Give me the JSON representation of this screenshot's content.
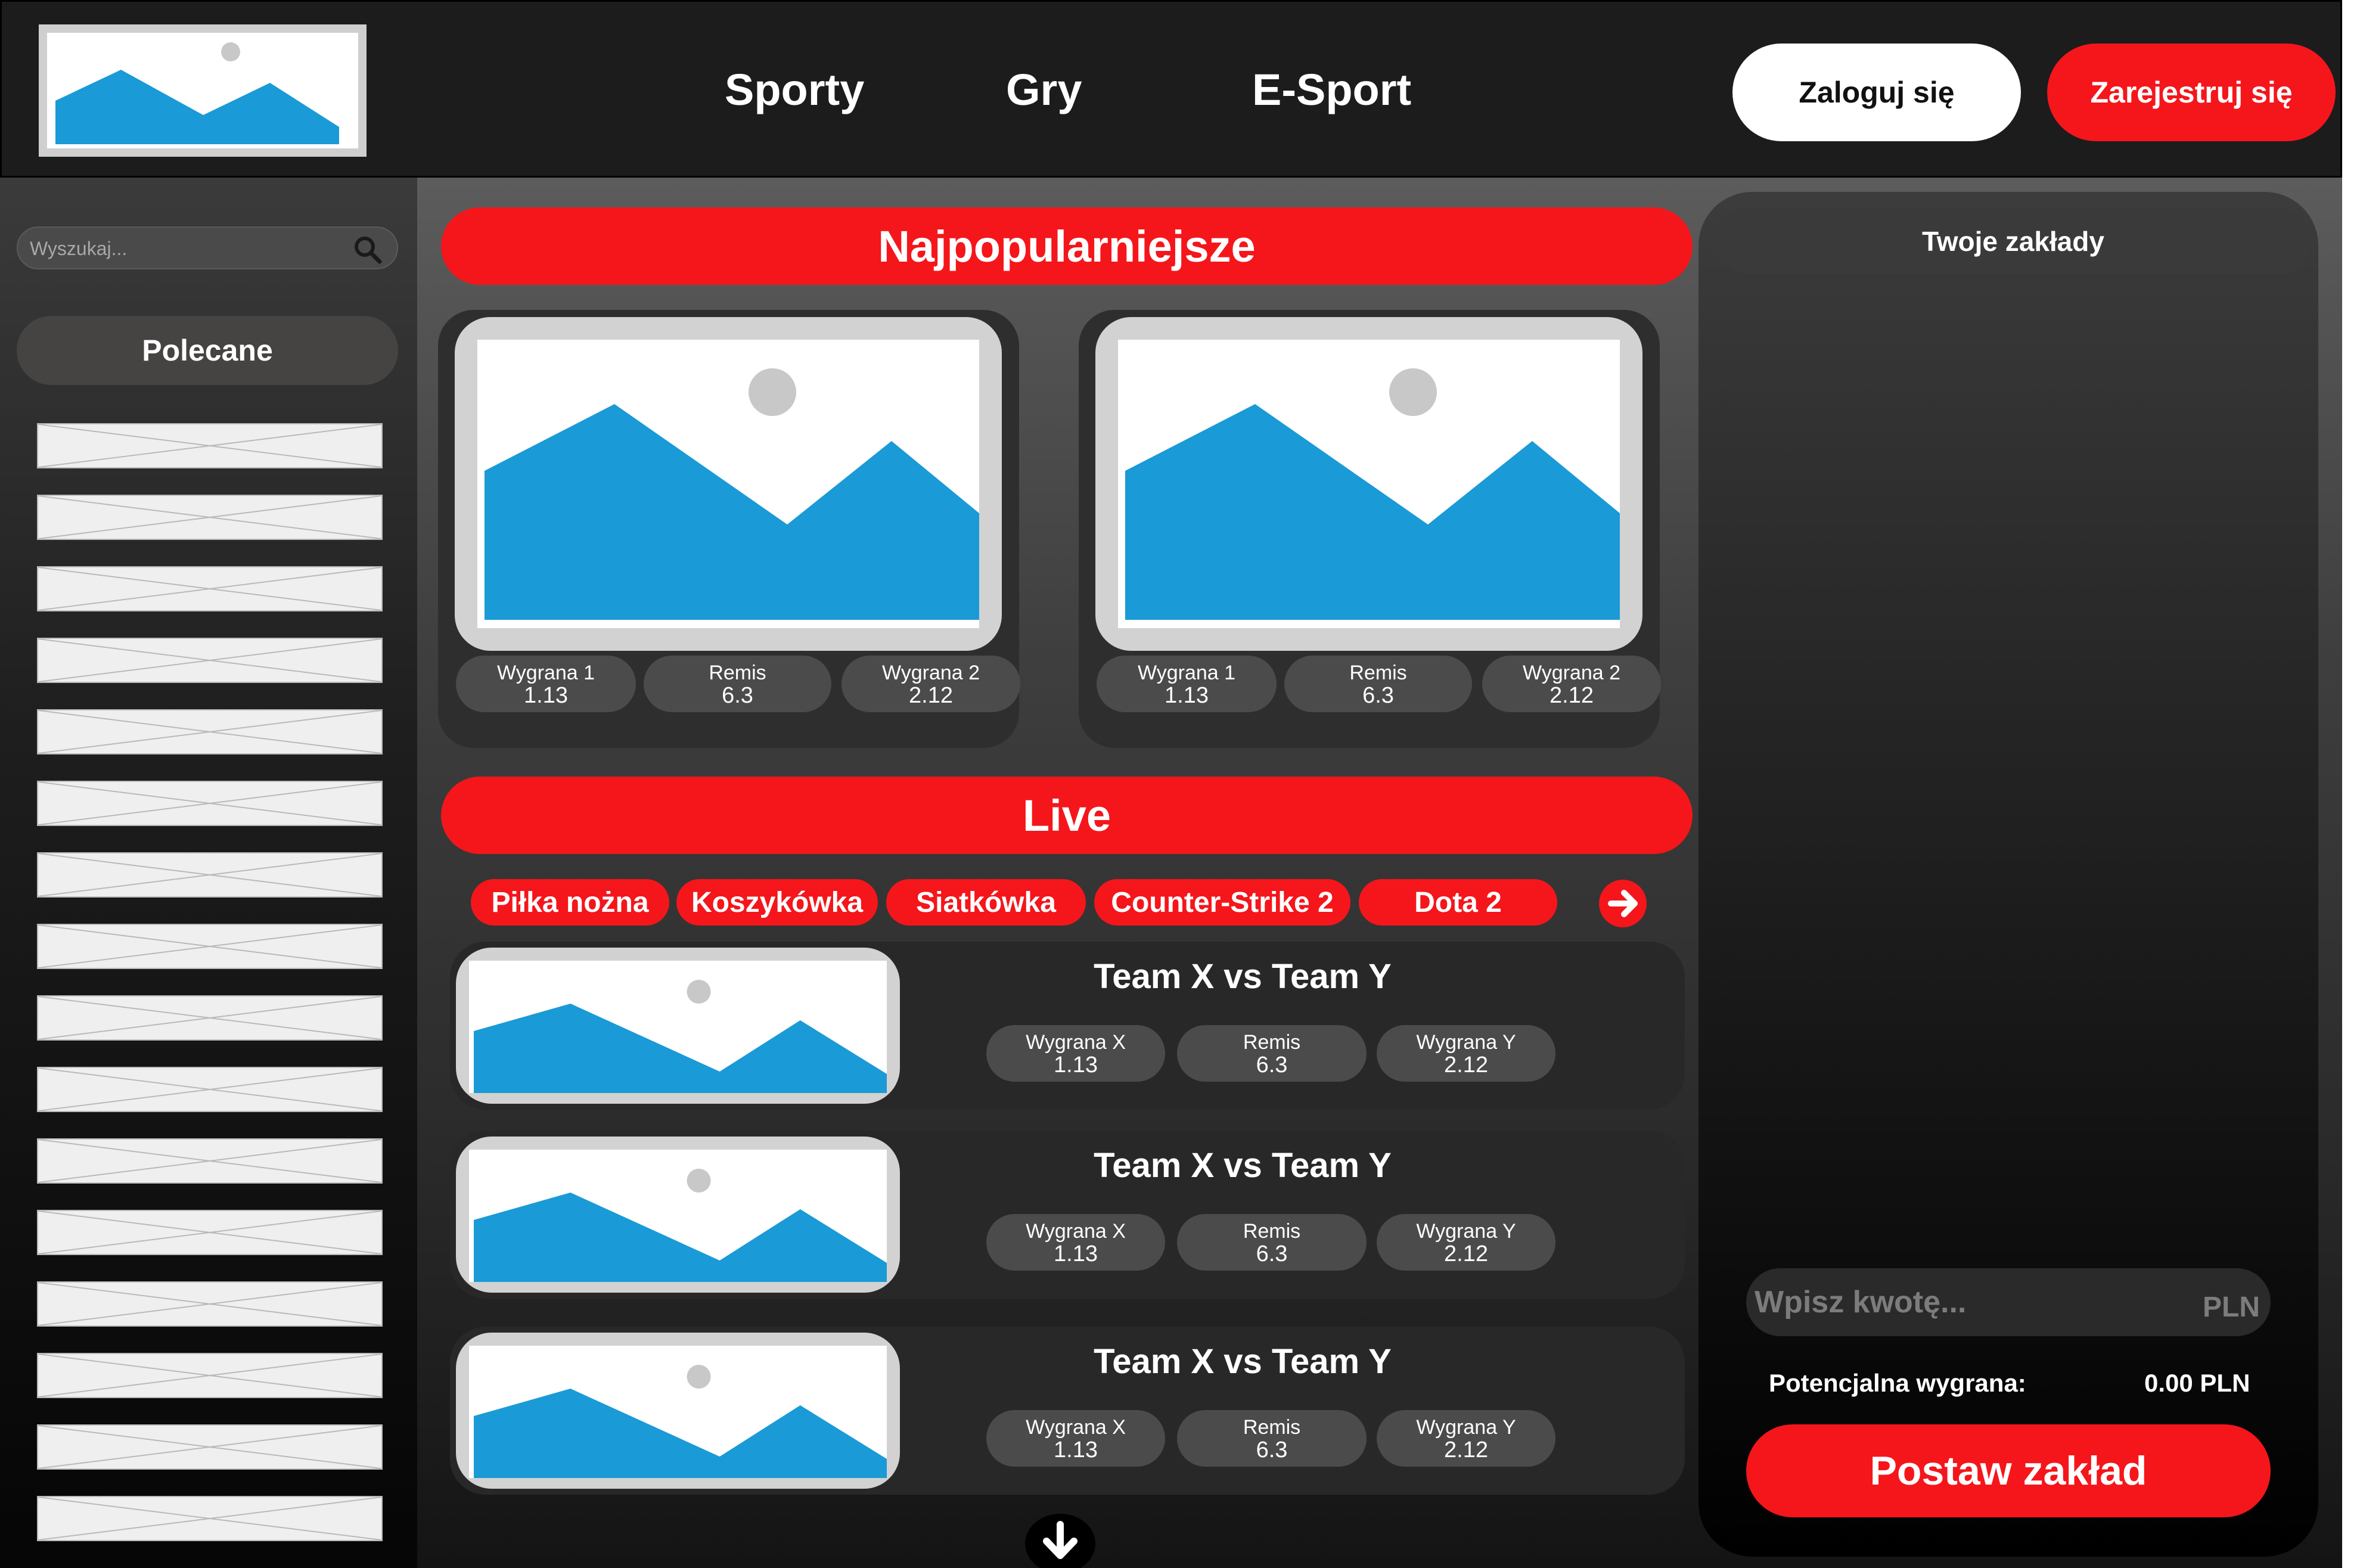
{
  "colors": {
    "accent": "#f4161b",
    "header_bg": "#1c1c1c",
    "pill_bg": "#4b4b4b",
    "image_blue": "#1a9ad6",
    "image_sun": "#c8c8c8"
  },
  "header": {
    "logo_icon": "image-placeholder-icon",
    "nav": [
      "Sporty",
      "Gry",
      "E-Sport"
    ],
    "login_label": "Zaloguj się",
    "register_label": "Zarejestruj się"
  },
  "sidebar": {
    "search_placeholder": "Wyszukaj...",
    "search_icon": "search-icon",
    "featured_label": "Polecane",
    "item_count_shown": 16
  },
  "popular": {
    "title": "Najpopularniejsze",
    "cards": [
      {
        "odds": [
          {
            "label": "Wygrana 1",
            "value": "1.13"
          },
          {
            "label": "Remis",
            "value": "6.3"
          },
          {
            "label": "Wygrana 2",
            "value": "2.12"
          }
        ]
      },
      {
        "odds": [
          {
            "label": "Wygrana 1",
            "value": "1.13"
          },
          {
            "label": "Remis",
            "value": "6.3"
          },
          {
            "label": "Wygrana 2",
            "value": "2.12"
          }
        ]
      }
    ]
  },
  "live": {
    "title": "Live",
    "tabs": [
      "Piłka nożna",
      "Koszykówka",
      "Siatkówka",
      "Counter-Strike 2",
      "Dota 2"
    ],
    "next_icon": "arrow-right-icon",
    "more_icon": "arrow-down-icon",
    "matches": [
      {
        "title": "Team X vs Team Y",
        "odds": [
          {
            "label": "Wygrana X",
            "value": "1.13"
          },
          {
            "label": "Remis",
            "value": "6.3"
          },
          {
            "label": "Wygrana Y",
            "value": "2.12"
          }
        ]
      },
      {
        "title": "Team X vs Team Y",
        "odds": [
          {
            "label": "Wygrana X",
            "value": "1.13"
          },
          {
            "label": "Remis",
            "value": "6.3"
          },
          {
            "label": "Wygrana Y",
            "value": "2.12"
          }
        ]
      },
      {
        "title": "Team X vs Team Y",
        "odds": [
          {
            "label": "Wygrana X",
            "value": "1.13"
          },
          {
            "label": "Remis",
            "value": "6.3"
          },
          {
            "label": "Wygrana Y",
            "value": "2.12"
          }
        ]
      }
    ]
  },
  "betslip": {
    "title": "Twoje zakłady",
    "amount_placeholder": "Wpisz kwotę...",
    "currency": "PLN",
    "potential_label": "Potencjalna wygrana:",
    "potential_value": "0.00 PLN",
    "place_label": "Postaw zakład"
  }
}
